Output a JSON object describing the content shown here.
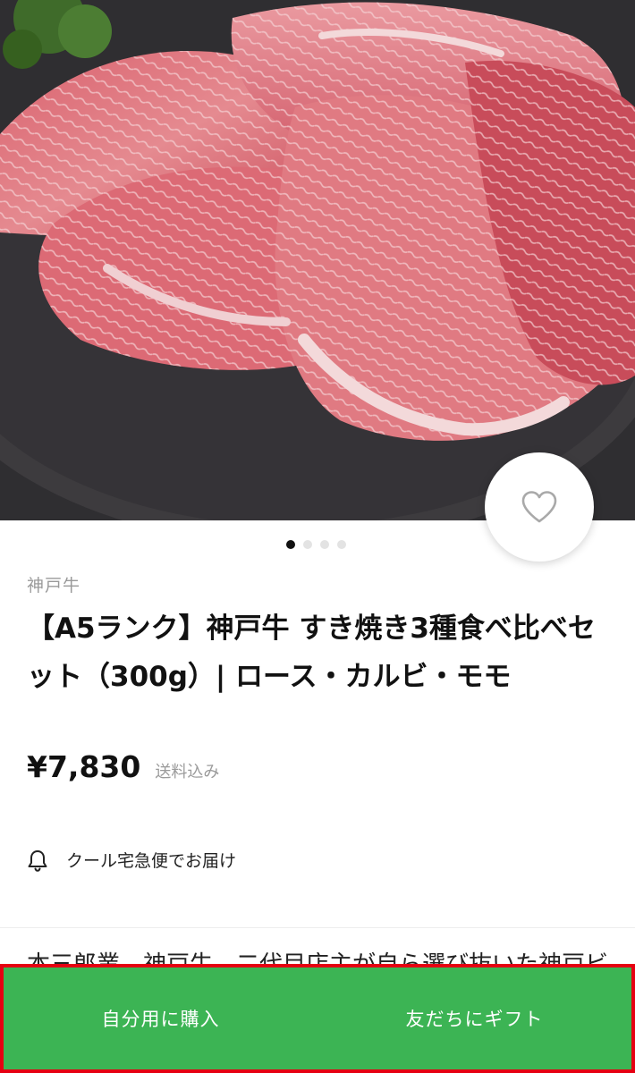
{
  "product": {
    "brand": "神戸牛",
    "title": "【A5ランク】神戸牛 すき焼き3種食べ比べセット（300g）| ロース・カルビ・モモ",
    "price": "¥7,830",
    "price_note": "送料込み"
  },
  "gallery": {
    "image_count": 4,
    "active_index": 0
  },
  "delivery": {
    "icon": "bell-icon",
    "text": "クール宅急便でお届け"
  },
  "description_peek": "本三郎業　神戸牛　二代目店主が自ら選び抜いた神戸ビ",
  "actions": {
    "buy_for_self": "自分用に購入",
    "gift_to_friend": "友だちにギフト"
  },
  "colors": {
    "cta_green": "#3cb454",
    "highlight_border": "#e60012"
  }
}
